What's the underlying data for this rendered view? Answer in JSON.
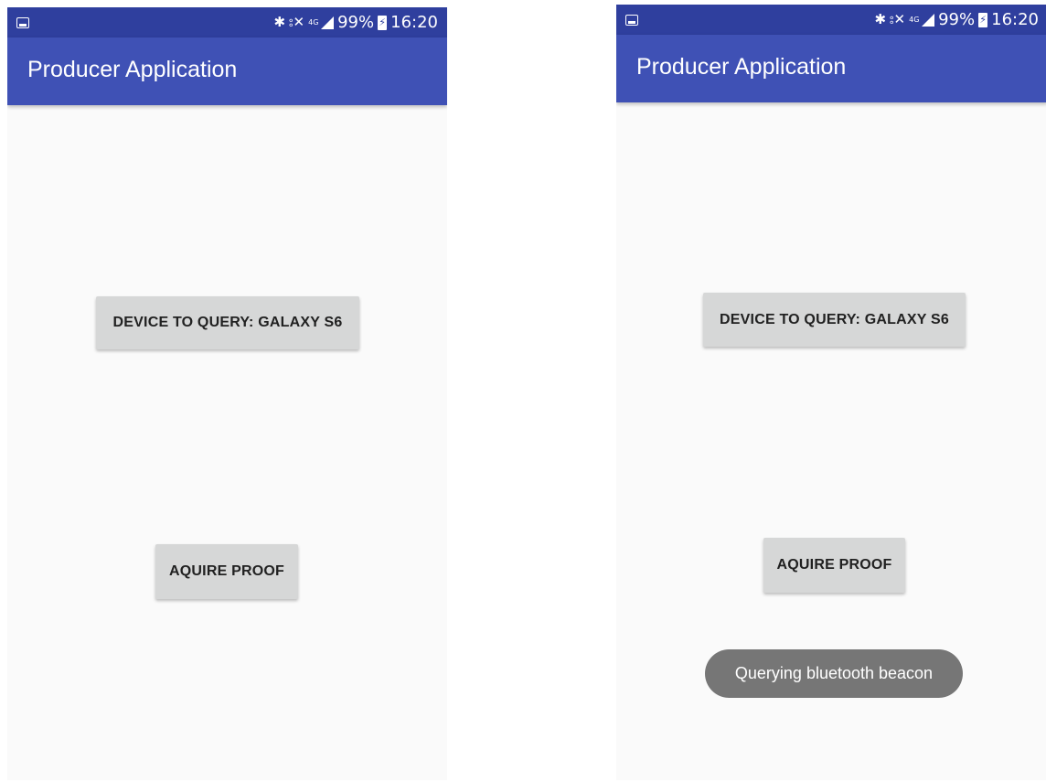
{
  "screens": [
    {
      "status_bar": {
        "left_icon": "gallery-icon",
        "icons": [
          "bluetooth-icon",
          "nfc-icon",
          "lte-icon",
          "signal-icon"
        ],
        "battery": "99%",
        "battery_icon": "battery-charging-icon",
        "time": "16:20",
        "lte_label": "4G"
      },
      "app_bar": {
        "title": "Producer Application"
      },
      "buttons": {
        "device": "DEVICE TO QUERY: GALAXY S6",
        "proof": "AQUIRE PROOF"
      }
    },
    {
      "status_bar": {
        "left_icon": "gallery-icon",
        "icons": [
          "bluetooth-icon",
          "nfc-icon",
          "lte-icon",
          "signal-icon"
        ],
        "battery": "99%",
        "battery_icon": "battery-charging-icon",
        "time": "16:20",
        "lte_label": "4G"
      },
      "app_bar": {
        "title": "Producer Application"
      },
      "buttons": {
        "device": "DEVICE TO QUERY: GALAXY S6",
        "proof": "AQUIRE PROOF"
      },
      "toast": "Querying bluetooth beacon"
    }
  ],
  "colors": {
    "status_bar": "#2f3f9e",
    "app_bar": "#3f51b5",
    "background": "#fafafa",
    "button": "#d6d7d7",
    "toast": "#767676"
  }
}
